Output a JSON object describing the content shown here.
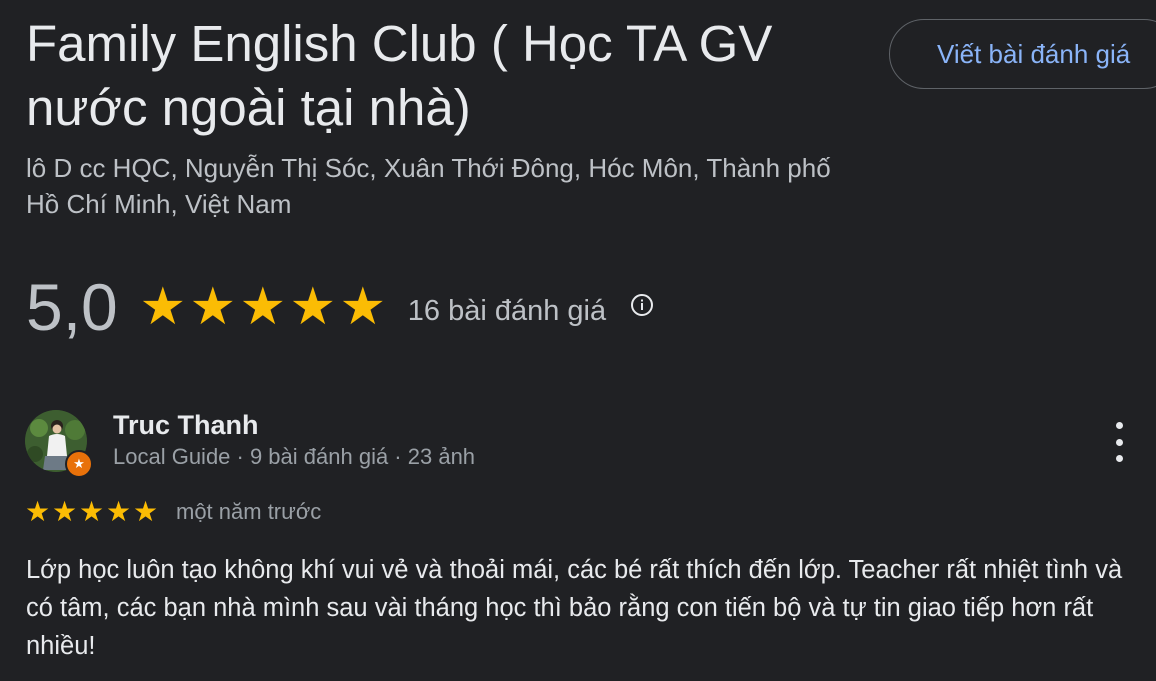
{
  "place": {
    "title": "Family English Club ( Học TA GV nước ngoài tại nhà)",
    "address": "lô D cc HQC, Nguyễn Thị Sóc, Xuân Thới Đông, Hóc Môn, Thành phố Hồ Chí Minh, Việt Nam"
  },
  "actions": {
    "write_review_label": "Viết bài đánh giá"
  },
  "rating": {
    "score": "5,0",
    "stars": 5,
    "review_count_label": "16 bài đánh giá",
    "info_icon": "info-icon"
  },
  "review": {
    "author_name": "Truc Thanh",
    "author_meta": "Local Guide · 9 bài đánh giá · 23 ảnh",
    "avatar_badge_icon": "local-guide-star-icon",
    "stars": 5,
    "time": "một năm trước",
    "text": "Lớp học luôn tạo không khí vui vẻ và thoải mái, các bé rất thích đến lớp. Teacher rất nhiệt tình và có tâm, các bạn nhà mình sau vài tháng học thì bảo rằng con tiến bộ và tự tin giao tiếp hơn rất nhiều!",
    "menu_icon": "more-vert-icon"
  },
  "colors": {
    "background": "#202124",
    "primary_text": "#e8eaed",
    "secondary_text": "#9aa0a6",
    "star": "#fbbc04",
    "link": "#8ab4f8",
    "badge": "#e8710a"
  }
}
